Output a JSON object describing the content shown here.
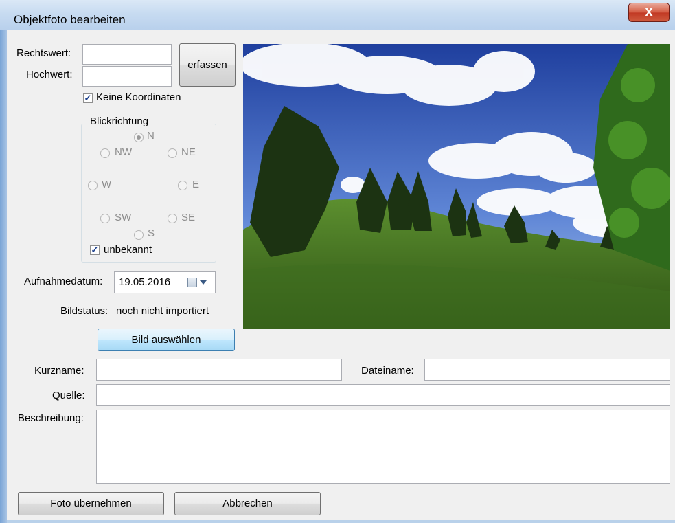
{
  "window": {
    "title": "Objektfoto bearbeiten",
    "close_label": "x"
  },
  "coords": {
    "rechtswert_label": "Rechtswert:",
    "rechtswert_value": "",
    "hochwert_label": "Hochwert:",
    "hochwert_value": "",
    "erfassen_label": "erfassen",
    "keine_koordinaten_label": "Keine Koordinaten",
    "keine_koordinaten_checked": true
  },
  "blickrichtung": {
    "title": "Blickrichtung",
    "options": [
      "N",
      "NW",
      "NE",
      "W",
      "E",
      "SW",
      "SE",
      "S"
    ],
    "selected": "N",
    "unbekannt_label": "unbekannt",
    "unbekannt_checked": true
  },
  "aufnahme": {
    "label": "Aufnahmedatum:",
    "value": "19.05.2016",
    "icon": "calendar-dropdown-icon"
  },
  "bildstatus": {
    "label": "Bildstatus:",
    "value": "noch nicht importiert"
  },
  "bild_auswaehlen_label": "Bild auswählen",
  "fields": {
    "kurzname_label": "Kurzname:",
    "kurzname_value": "",
    "dateiname_label": "Dateiname:",
    "dateiname_value": "",
    "quelle_label": "Quelle:",
    "quelle_value": "",
    "beschreibung_label": "Beschreibung:",
    "beschreibung_value": ""
  },
  "buttons": {
    "ok_label": "Foto übernehmen",
    "cancel_label": "Abbrechen"
  },
  "colors": {
    "titlebar": "#c7dbf1",
    "client": "#f0f0f0",
    "close": "#c13a24",
    "accent": "#3c7fb1"
  }
}
